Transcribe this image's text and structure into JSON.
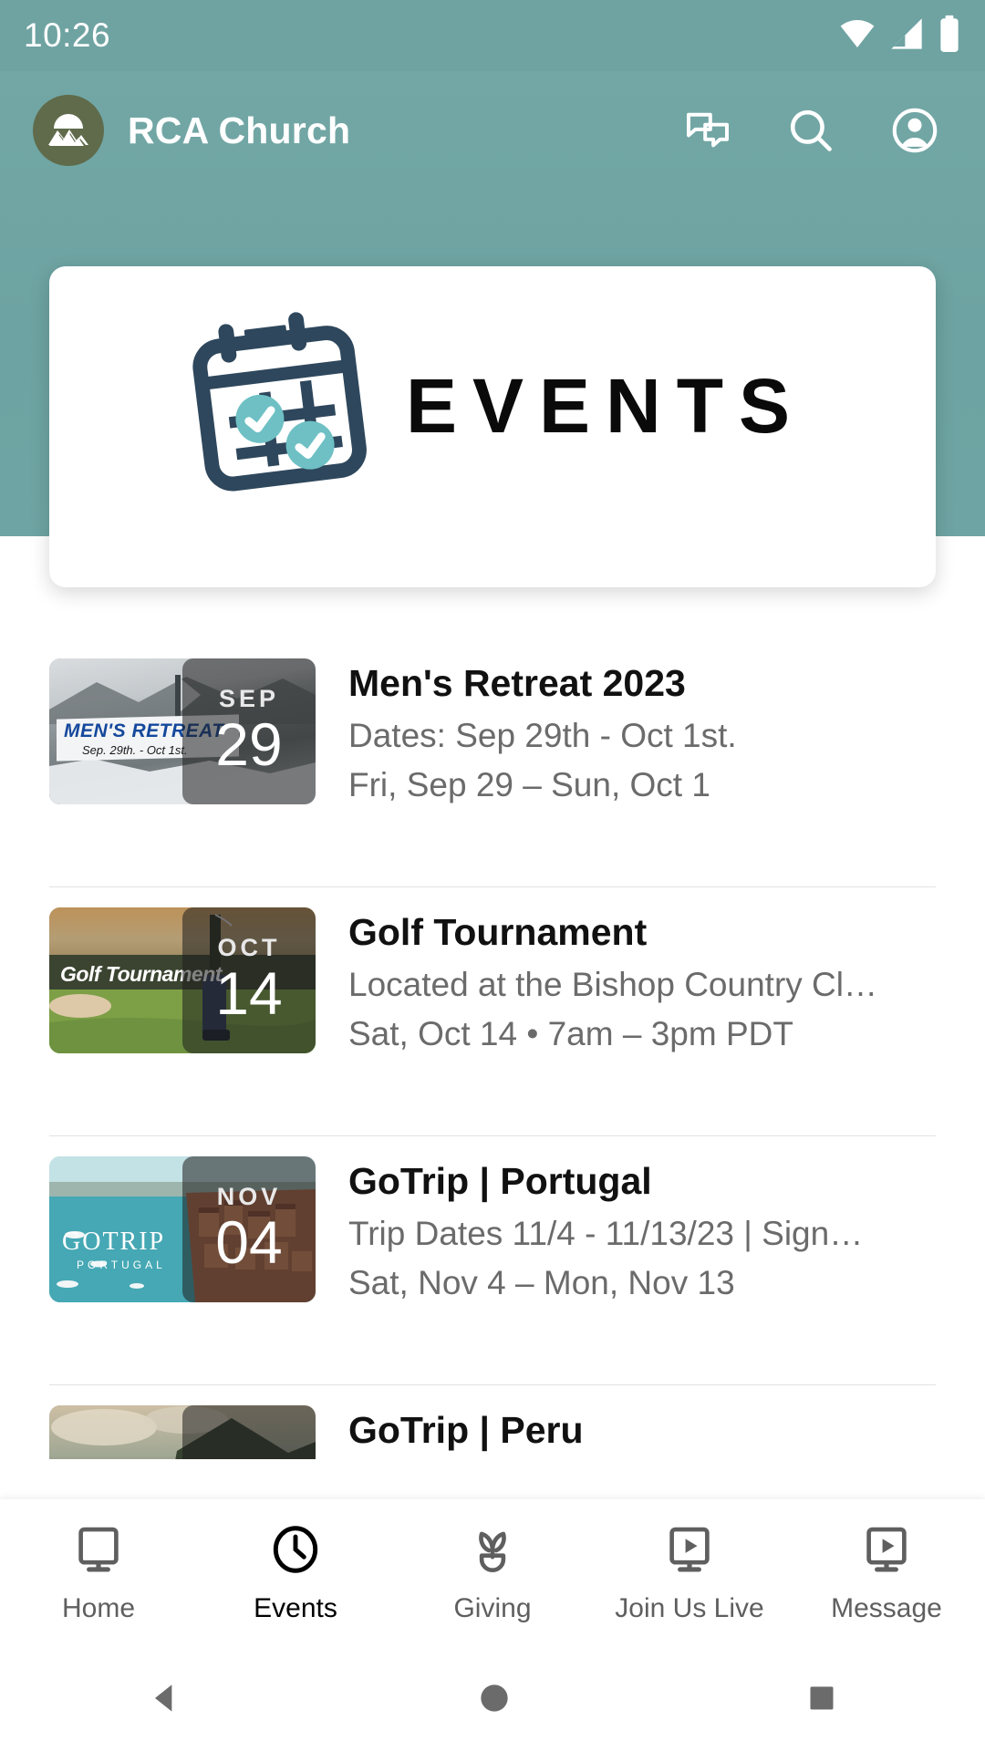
{
  "status_bar": {
    "time": "10:26",
    "icons": [
      "wifi-icon",
      "cellular-signal-icon",
      "battery-icon"
    ]
  },
  "header": {
    "app_title": "RCA Church",
    "logo": "mountain-logo-icon",
    "background_color": "#6fa3a2",
    "actions": [
      {
        "name": "chat-icon",
        "label": "Chat"
      },
      {
        "name": "search-icon",
        "label": "Search"
      },
      {
        "name": "account-icon",
        "label": "Account"
      }
    ]
  },
  "banner": {
    "title": "EVENTS",
    "icon": "calendar-check-icon",
    "icon_color": "#2e475c",
    "accent_color": "#6ec0c4"
  },
  "events": [
    {
      "title": "Men's Retreat 2023",
      "subtitle": "Dates: Sep 29th - Oct 1st.",
      "when": "Fri, Sep 29 – Sun, Oct 1",
      "month": "SEP",
      "day": "29",
      "thumb_caption": "MEN'S RETREAT",
      "thumb_subcaption": "Sep. 29th. - Oct 1st."
    },
    {
      "title": "Golf Tournament",
      "subtitle": "Located at the Bishop Country Cl…",
      "when": "Sat, Oct 14 • 7am – 3pm PDT",
      "month": "OCT",
      "day": "14",
      "thumb_caption": "Golf Tournament",
      "thumb_subcaption": ""
    },
    {
      "title": "GoTrip | Portugal",
      "subtitle": "Trip Dates 11/4 - 11/13/23 | Sign…",
      "when": "Sat, Nov 4 – Mon, Nov 13",
      "month": "NOV",
      "day": "04",
      "thumb_caption": "GOTRIP",
      "thumb_subcaption": "PORTUGAL"
    },
    {
      "title": "GoTrip | Peru",
      "subtitle": "",
      "when": "",
      "month": "",
      "day": "",
      "thumb_caption": "",
      "thumb_subcaption": ""
    }
  ],
  "bottom_nav": {
    "active": "Events",
    "items": [
      {
        "label": "Home",
        "icon": "monitor-icon"
      },
      {
        "label": "Events",
        "icon": "clock-icon"
      },
      {
        "label": "Giving",
        "icon": "plant-sprout-icon"
      },
      {
        "label": "Join Us Live",
        "icon": "monitor-play-icon"
      },
      {
        "label": "Message",
        "icon": "monitor-play-icon"
      }
    ]
  },
  "system_nav": {
    "items": [
      "back-triangle-icon",
      "home-circle-icon",
      "recents-square-icon"
    ]
  }
}
